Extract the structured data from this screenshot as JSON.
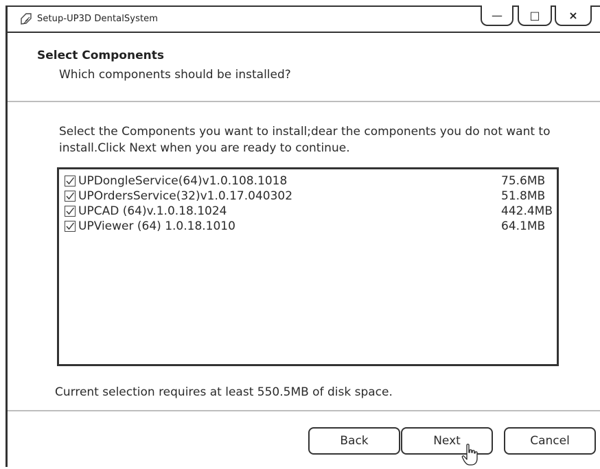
{
  "window": {
    "title": "Setup-UP3D DentalSystem",
    "controls": {
      "minimize_glyph": "—",
      "maximize_glyph": "□",
      "close_glyph": "×"
    }
  },
  "header": {
    "title": "Select Components",
    "subtitle": "Which components should be installed?"
  },
  "instructions": "Select  the Components you want to install;dear the components you do not want to install.Click Next when you are ready to continue.",
  "components": [
    {
      "name": "UPDongleService(64)v1.0.108.1018",
      "size": "75.6MB",
      "checked": true
    },
    {
      "name": "UPOrdersService(32)v1.0.17.040302",
      "size": "51.8MB",
      "checked": true
    },
    {
      "name": "UPCAD (64)v.1.0.18.1024",
      "size": "442.4MB",
      "checked": true
    },
    {
      "name": "UPViewer (64) 1.0.18.1010",
      "size": "64.1MB",
      "checked": true
    }
  ],
  "disk_space": "Current selection requires at least 550.5MB of disk space.",
  "buttons": {
    "back": "Back",
    "next": "Next",
    "cancel": "Cancel"
  },
  "icons": {
    "app": "app-logo-icon",
    "check": "checkmark-icon",
    "cursor": "hand-pointer-icon"
  }
}
